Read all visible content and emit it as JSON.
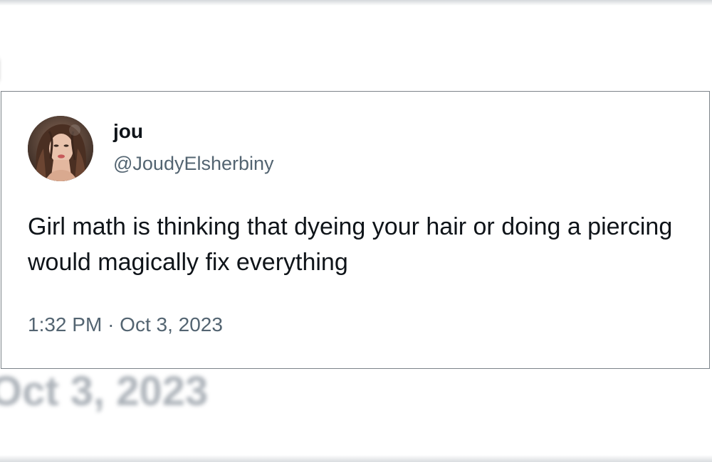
{
  "background": {
    "blurred_name_fragment": "u",
    "blurred_date": "Oct 3, 2023"
  },
  "tweet": {
    "avatar_icon": "profile-photo",
    "display_name": "jou",
    "handle": "@JoudyElsherbiny",
    "text": "Girl math is thinking that dyeing your hair or doing a piercing would magically fix everything",
    "time": "1:32 PM",
    "separator": "·",
    "date": "Oct 3, 2023"
  },
  "colors": {
    "text_primary": "#0f1419",
    "text_secondary": "#536471",
    "card_border": "#7c8389"
  }
}
